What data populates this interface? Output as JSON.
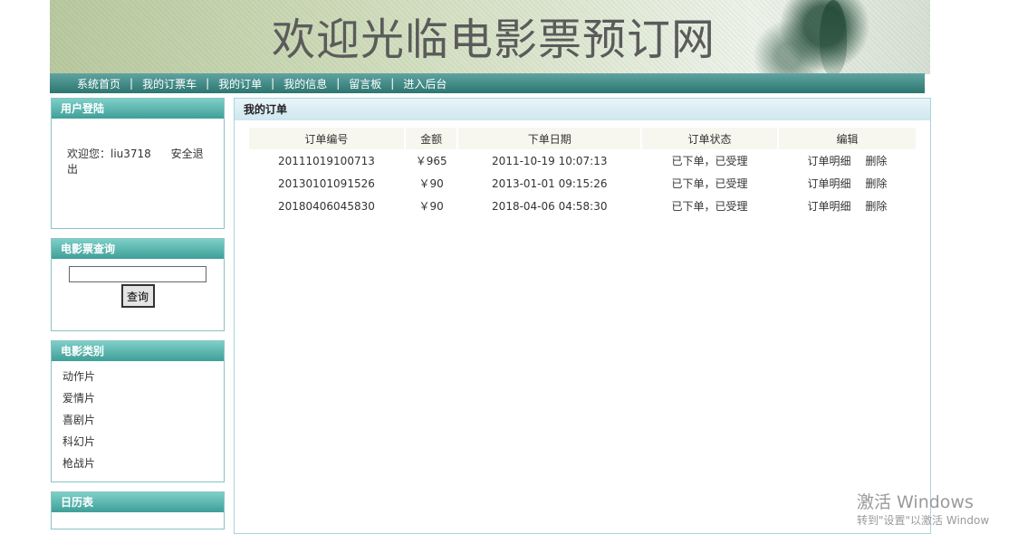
{
  "site_title": "欢迎光临电影票预订网",
  "nav": {
    "items": [
      "系统首页",
      "我的订票车",
      "我的订单",
      "我的信息",
      "留言板",
      "进入后台"
    ],
    "separator": "|"
  },
  "login": {
    "title": "用户登陆",
    "welcome": "欢迎您：liu3718",
    "logout": "安全退出"
  },
  "search": {
    "title": "电影票查询",
    "value": "",
    "button": "查询"
  },
  "categories": {
    "title": "电影类别",
    "items": [
      "动作片",
      "爱情片",
      "喜剧片",
      "科幻片",
      "枪战片"
    ]
  },
  "calendar": {
    "title": "日历表"
  },
  "orders": {
    "title": "我的订单",
    "columns": [
      "订单编号",
      "金额",
      "下单日期",
      "订单状态",
      "编辑"
    ],
    "rows": [
      {
        "id": "20111019100713",
        "amount": "￥965",
        "date": "2011-10-19 10:07:13",
        "status": "已下单，已受理",
        "detail": "订单明细",
        "delete": "删除"
      },
      {
        "id": "20130101091526",
        "amount": "￥90",
        "date": "2013-01-01 09:15:26",
        "status": "已下单，已受理",
        "detail": "订单明细",
        "delete": "删除"
      },
      {
        "id": "20180406045830",
        "amount": "￥90",
        "date": "2018-04-06 04:58:30",
        "status": "已下单，已受理",
        "detail": "订单明细",
        "delete": "删除"
      }
    ]
  },
  "watermark": {
    "line1": "激活 Windows",
    "line2": "转到\"设置\"以激活 Window"
  },
  "colors": {
    "nav_bg": "#2c7670",
    "box_head": "#3e9f98",
    "box_border": "#8ac3c3",
    "table_header_bg": "#f7f7ef"
  }
}
